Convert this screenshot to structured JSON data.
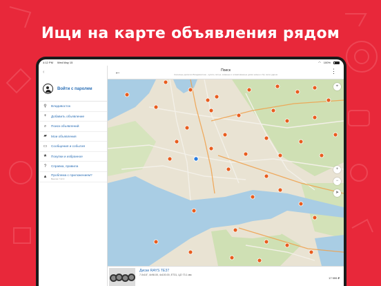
{
  "headline": "Ищи на карте объявления рядом",
  "status_bar": {
    "time": "4:12 PM",
    "date": "Wed May 15",
    "battery": "100%"
  },
  "sidebar": {
    "login_label": "Войти с паролем",
    "items": [
      {
        "icon": "location-pin-icon",
        "label": "Владивосток"
      },
      {
        "icon": "plus-icon",
        "label": "Добавить объявление"
      },
      {
        "icon": "search-icon",
        "label": "Поиск объявлений"
      },
      {
        "icon": "folder-icon",
        "label": "Мои объявления"
      },
      {
        "icon": "message-icon",
        "label": "Сообщения и события"
      },
      {
        "icon": "star-icon",
        "label": "Покупки и избранное"
      },
      {
        "icon": "help-icon",
        "label": "Справка, правила"
      },
      {
        "icon": "warning-icon",
        "label": "Проблема с приложением?",
        "sub": "Версия 7.22.0"
      }
    ]
  },
  "main": {
    "title": "Поиск",
    "subtitle": "Колесные диски во Владивостоке - купить литые, кованые и штампованные диски новые и б/у легко даром"
  },
  "listing": {
    "title": "Диски RAYS TE37",
    "description": "7.0x16\", 4x98.00, 4x100.00, ET31, ЦО 73.1 мм",
    "price": "17 999 ₽"
  },
  "colors": {
    "brand_red": "#e8283a",
    "link_blue": "#2b6fb6",
    "marker_orange": "#e85d1f",
    "water": "#a9cde4",
    "land": "#e9e3d3",
    "park": "#cfe0b4"
  }
}
